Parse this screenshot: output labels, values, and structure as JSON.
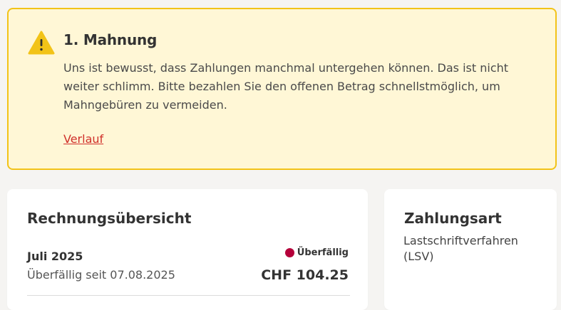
{
  "alert": {
    "icon": "warning-icon",
    "title": "1. Mahnung",
    "body": "Uns ist bewusst, dass Zahlungen manchmal untergehen können. Das ist nicht weiter schlimm. Bitte bezahlen Sie den offenen Betrag schnellstmöglich, um Mahngebüren zu vermeiden.",
    "link": "Verlauf",
    "accent": "#f2c318",
    "background": "#fff7d6"
  },
  "overview": {
    "title": "Rechnungsübersicht",
    "invoice": {
      "month": "Juli 2025",
      "due": "Überfällig seit 07.08.2025",
      "status": "Überfällig",
      "status_color": "#b5003a",
      "amount": "CHF 104.25"
    }
  },
  "payment": {
    "title": "Zahlungsart",
    "method": "Lastschriftverfahren (LSV)"
  }
}
